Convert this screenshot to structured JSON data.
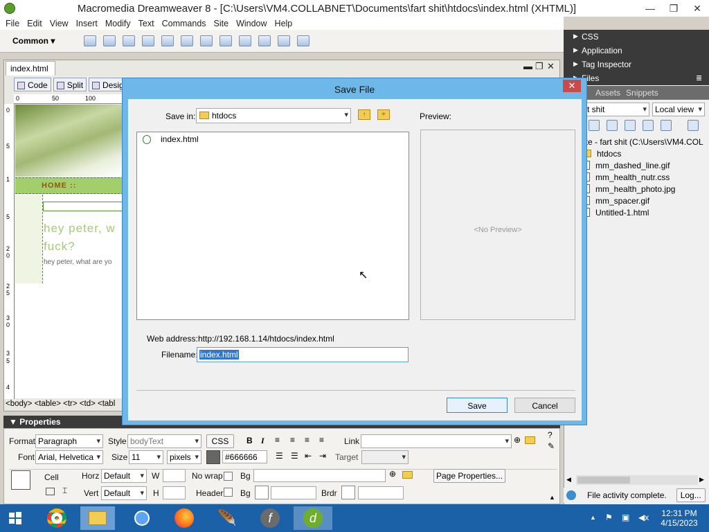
{
  "window": {
    "title": "Macromedia Dreamweaver 8 - [C:\\Users\\VM4.COLLABNET\\Documents\\fart shit\\htdocs\\index.html (XHTML)]"
  },
  "menu": [
    "File",
    "Edit",
    "View",
    "Insert",
    "Modify",
    "Text",
    "Commands",
    "Site",
    "Window",
    "Help"
  ],
  "insert_bar": {
    "category": "Common"
  },
  "document": {
    "tab": "index.html",
    "views": [
      "Code",
      "Split",
      "Desig"
    ],
    "ruler_h": [
      "0",
      "50",
      "100"
    ],
    "ruler_v": [
      "0",
      "5",
      "1",
      "5",
      "2",
      "0",
      "2",
      "5",
      "3",
      "0",
      "3",
      "5",
      "4"
    ],
    "nav_text": "HOME  ::",
    "heading": "hey peter, w fuck?",
    "subtext": "hey peter, what are yo",
    "tag_selector": "<body> <table> <tr> <td> <tabl"
  },
  "properties": {
    "header": "Properties",
    "format_label": "Format",
    "format_value": "Paragraph",
    "style_label": "Style",
    "style_value": "bodyText",
    "css_button": "CSS",
    "link_label": "Link",
    "font_label": "Font",
    "font_value": "Arial, Helvetica",
    "size_label": "Size",
    "size_value": "11",
    "size_unit": "pixels",
    "color_value": "#666666",
    "target_label": "Target",
    "cell_label": "Cell",
    "horz_label": "Horz",
    "horz_value": "Default",
    "w_label": "W",
    "nowrap_label": "No wrap",
    "bg_label": "Bg",
    "page_props_button": "Page Properties...",
    "vert_label": "Vert",
    "vert_value": "Default",
    "h_label": "H",
    "header_label": "Header",
    "brdr_label": "Brdr"
  },
  "panels": {
    "groups": [
      "CSS",
      "Application",
      "Tag Inspector",
      "Files"
    ],
    "tabs": [
      "Assets",
      "Snippets"
    ],
    "site_select": "rt shit",
    "view_select": "Local view",
    "tree_root": "Site - fart shit (C:\\Users\\VM4.COL",
    "files": [
      {
        "name": "htdocs",
        "type": "folder"
      },
      {
        "name": "mm_dashed_line.gif",
        "type": "file"
      },
      {
        "name": "mm_health_nutr.css",
        "type": "file"
      },
      {
        "name": "mm_health_photo.jpg",
        "type": "file"
      },
      {
        "name": "mm_spacer.gif",
        "type": "file"
      },
      {
        "name": "Untitled-1.html",
        "type": "file"
      }
    ],
    "status": "File activity complete.",
    "log_button": "Log..."
  },
  "dialog": {
    "title": "Save File",
    "save_in_label": "Save in:",
    "save_in_value": "htdocs",
    "preview_label": "Preview:",
    "no_preview": "<No Preview>",
    "files": [
      "index.html"
    ],
    "web_address_label": "Web address:",
    "web_address_value": "http://192.168.1.14/htdocs/index.html",
    "filename_label": "Filename:",
    "filename_value": "index.html",
    "save_button": "Save",
    "cancel_button": "Cancel"
  },
  "taskbar": {
    "time": "12:31 PM",
    "date": "4/15/2023"
  },
  "colors": {
    "dialog_frame": "#6eb8e9",
    "taskbar": "#1b61a8",
    "panel_header": "#3a3a3a",
    "selection": "#3077d0"
  }
}
